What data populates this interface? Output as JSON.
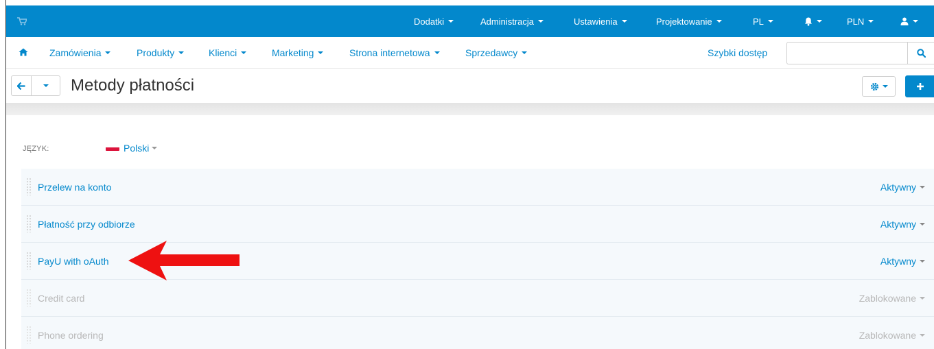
{
  "topbar": {
    "cart_icon": "shopping-cart-icon",
    "menus": [
      {
        "label": "Dodatki"
      },
      {
        "label": "Administracja"
      },
      {
        "label": "Ustawienia"
      },
      {
        "label": "Projektowanie"
      },
      {
        "label": "PL"
      },
      {
        "label": "PLN"
      }
    ],
    "bell_icon": "bell-icon",
    "user_icon": "user-icon",
    "color": "#0388cc"
  },
  "nav": {
    "home_icon": "home-icon",
    "items": [
      {
        "label": "Zamówienia"
      },
      {
        "label": "Produkty"
      },
      {
        "label": "Klienci"
      },
      {
        "label": "Marketing"
      },
      {
        "label": "Strona internetowa"
      },
      {
        "label": "Sprzedawcy"
      }
    ],
    "quick_access": "Szybki dostęp",
    "search_value": "",
    "search_icon": "search-icon"
  },
  "page": {
    "title": "Metody płatności",
    "back_icon": "arrow-left-icon",
    "gear_icon": "gear-icon",
    "add_icon": "plus-icon"
  },
  "language": {
    "label": "JĘZYK:",
    "selected": "Polski",
    "flag_icon": "poland-flag-icon"
  },
  "payment_methods": [
    {
      "name": "Przelew na konto",
      "status": "Aktywny",
      "enabled": true
    },
    {
      "name": "Płatność przy odbiorze",
      "status": "Aktywny",
      "enabled": true
    },
    {
      "name": "PayU with oAuth",
      "status": "Aktywny",
      "enabled": true
    },
    {
      "name": "Credit card",
      "status": "Zablokowane",
      "enabled": false
    },
    {
      "name": "Phone ordering",
      "status": "Zablokowane",
      "enabled": false
    }
  ],
  "annotation": {
    "arrow_icon": "red-arrow-left-icon",
    "color": "#ee1111"
  },
  "colors": {
    "accent": "#0388cc",
    "disabled": "#b8b8b8"
  }
}
